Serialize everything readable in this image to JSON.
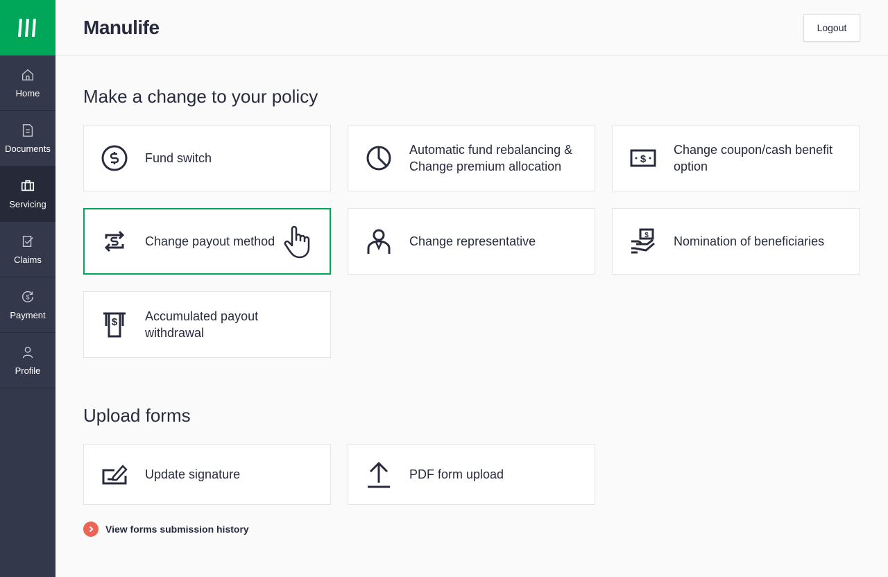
{
  "brand": {
    "name": "Manulife",
    "color": "#00a758"
  },
  "header": {
    "logout_label": "Logout"
  },
  "sidebar": {
    "items": [
      {
        "label": "Home",
        "icon": "home-icon",
        "active": false
      },
      {
        "label": "Documents",
        "icon": "document-icon",
        "active": false
      },
      {
        "label": "Servicing",
        "icon": "briefcase-icon",
        "active": true
      },
      {
        "label": "Claims",
        "icon": "claims-icon",
        "active": false
      },
      {
        "label": "Payment",
        "icon": "payment-icon",
        "active": false
      },
      {
        "label": "Profile",
        "icon": "profile-icon",
        "active": false
      }
    ]
  },
  "policy_section": {
    "title": "Make a change to your policy",
    "cards": [
      {
        "label": "Fund switch",
        "icon": "fund-switch-icon"
      },
      {
        "label": "Automatic fund rebalancing & Change premium allocation",
        "icon": "pie-chart-icon"
      },
      {
        "label": "Change coupon/cash benefit option",
        "icon": "cash-note-icon"
      },
      {
        "label": "Change payout method",
        "icon": "exchange-dollar-icon",
        "selected": true
      },
      {
        "label": "Change representative",
        "icon": "representative-icon"
      },
      {
        "label": "Nomination of beneficiaries",
        "icon": "hand-money-icon"
      },
      {
        "label": "Accumulated payout withdrawal",
        "icon": "withdrawal-icon"
      }
    ]
  },
  "forms_section": {
    "title": "Upload forms",
    "cards": [
      {
        "label": "Update signature",
        "icon": "signature-icon"
      },
      {
        "label": "PDF form upload",
        "icon": "upload-icon"
      }
    ],
    "history_link": "View forms submission history"
  },
  "colors": {
    "accent": "#00a758",
    "sidebar_bg": "#34384b",
    "sidebar_active": "#262938",
    "link_arrow": "#ec6453",
    "text": "#282b3e"
  }
}
